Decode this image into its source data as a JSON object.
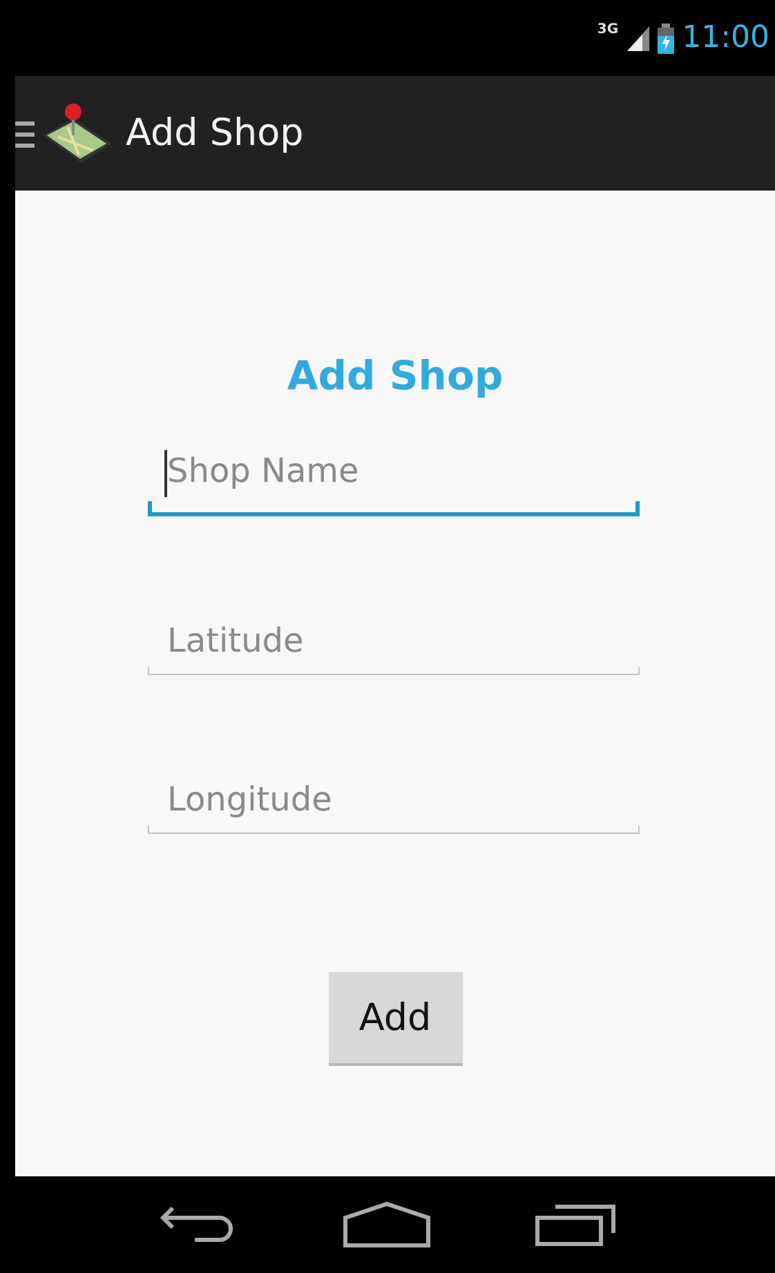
{
  "status_bar": {
    "network": "3G",
    "time": "11:00"
  },
  "action_bar": {
    "title": "Add Shop"
  },
  "form": {
    "heading": "Add Shop",
    "fields": [
      {
        "placeholder": "Shop Name",
        "focused": true
      },
      {
        "placeholder": "Latitude",
        "focused": false
      },
      {
        "placeholder": "Longitude",
        "focused": false
      }
    ],
    "button": "Add"
  }
}
